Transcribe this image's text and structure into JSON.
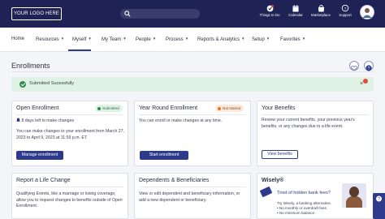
{
  "header": {
    "logo_text": "YOUR LOGO HERE",
    "nav_icons": [
      {
        "icon": "checkmark-badge-icon",
        "label": "Things to Do"
      },
      {
        "icon": "calendar-icon",
        "label": "Calendar"
      },
      {
        "icon": "marketplace-icon",
        "label": "Marketplace"
      },
      {
        "icon": "help-bubble-icon",
        "label": "Support"
      }
    ]
  },
  "subnav": {
    "items": [
      {
        "label": "Home",
        "caret": false
      },
      {
        "label": "Resources",
        "caret": true
      },
      {
        "label": "Myself",
        "caret": true,
        "active": true
      },
      {
        "label": "My Team",
        "caret": true
      },
      {
        "label": "People",
        "caret": true
      },
      {
        "label": "Process",
        "caret": true
      },
      {
        "label": "Reports & Analytics",
        "caret": true
      },
      {
        "label": "Setup",
        "caret": true
      },
      {
        "label": "Favorites",
        "caret": true
      }
    ]
  },
  "page": {
    "title": "Enrollments"
  },
  "banner": {
    "message": "Submitted Sucessfully"
  },
  "cards": {
    "open_enrollment": {
      "title": "Open Enrollment",
      "badge": "Submitted",
      "days_left": "8 days left to make changes",
      "body": "You can make changes to your enrollment from March 27, 2023 to April 9, 2023 at 11:59 p.m. ET.",
      "button": "Manage enrollment"
    },
    "year_round": {
      "title": "Year Round Enrollment",
      "badge": "Not started",
      "body": "You can enroll or make changes at any time.",
      "button": "Start enrollment"
    },
    "your_benefits": {
      "title": "Your Benefits",
      "body": "Review your current benefits, your previous year's benefits, or any changes due to a life event.",
      "button": "View benefits"
    },
    "life_change": {
      "title": "Report a Life Change",
      "body": "Qualifying Events, like a marriage or losing coverage, allow you to request changes to benefits outside of Open Enrollment."
    },
    "dependents": {
      "title": "Dependents & Beneficiaries",
      "body": "View or edit dependent and beneficiary information, or add a new dependent or beneficiary."
    },
    "wisely": {
      "title": "Wisely®",
      "headline": "Tired of hidden bank fees?",
      "tagline": "Try Wisely, a banking alternative.",
      "bullets": [
        "No monthly or overdraft fees.",
        "No minimum balance."
      ]
    }
  },
  "colors": {
    "header_bg": "#1f2255",
    "primary": "#2e3a8c",
    "success_bg": "#dff2e4",
    "warning_dot": "#e07a32"
  }
}
